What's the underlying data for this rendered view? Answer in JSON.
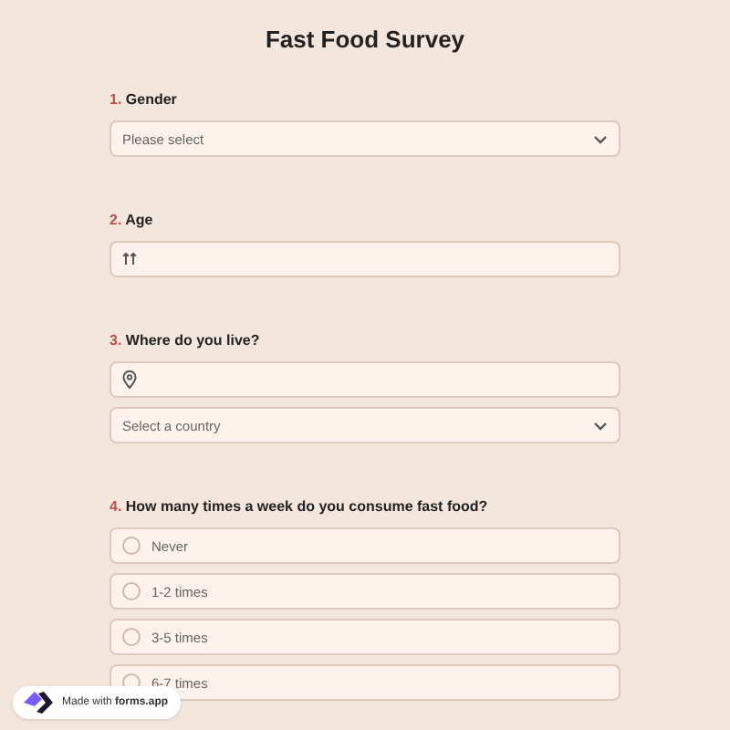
{
  "title": "Fast Food Survey",
  "questions": [
    {
      "number": "1.",
      "label": "Gender",
      "kind": "select",
      "placeholder": "Please select"
    },
    {
      "number": "2.",
      "label": "Age",
      "kind": "number"
    },
    {
      "number": "3.",
      "label": "Where do you live?",
      "kind": "location",
      "country_placeholder": "Select a country"
    },
    {
      "number": "4.",
      "label": "How many times a week do you consume fast food?",
      "kind": "radio",
      "options": [
        {
          "label": "Never",
          "selected": false
        },
        {
          "label": "1-2 times",
          "selected": false
        },
        {
          "label": "3-5 times",
          "selected": false
        },
        {
          "label": "6-7 times",
          "selected": false
        }
      ]
    }
  ],
  "badge": "Made with **forms.app**"
}
